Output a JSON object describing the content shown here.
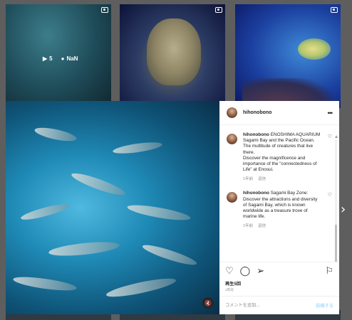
{
  "grid": {
    "tile1": {
      "play_count": "5",
      "comment_count": "NaN"
    }
  },
  "post": {
    "username": "hihonobono",
    "comments": [
      {
        "username": "hihonobono",
        "text": "ENOSHIMA AQUARIUM\nSagami Bay and the Pacific Ocean.\nThe multitude of creatures that live there.\nDiscover the magnificence and importance of the \"connectedness of Life\" at Enosui.",
        "time": "1年前",
        "reply_label": "返信"
      },
      {
        "username": "hihonobono",
        "text": "Sagami Bay Zone: Discover the attractions and diversity of Sagami Bay, which is known worldwide as a treasure trove of marine life.",
        "time": "1年前",
        "reply_label": "返信"
      }
    ],
    "views": "再生5回",
    "posted": "1年前",
    "comment_placeholder": "コメントを追加...",
    "post_label": "投稿する"
  },
  "icons": {
    "more": "more-icon",
    "heart": "heart-icon",
    "comment": "comment-icon",
    "share": "share-icon",
    "bookmark": "bookmark-icon",
    "mute": "mute-icon",
    "next": "chevron-right-icon",
    "video": "video-icon",
    "play": "play-icon"
  },
  "colors": {
    "link_disabled": "#b2dffc",
    "meta_text": "#8e8e8e"
  }
}
